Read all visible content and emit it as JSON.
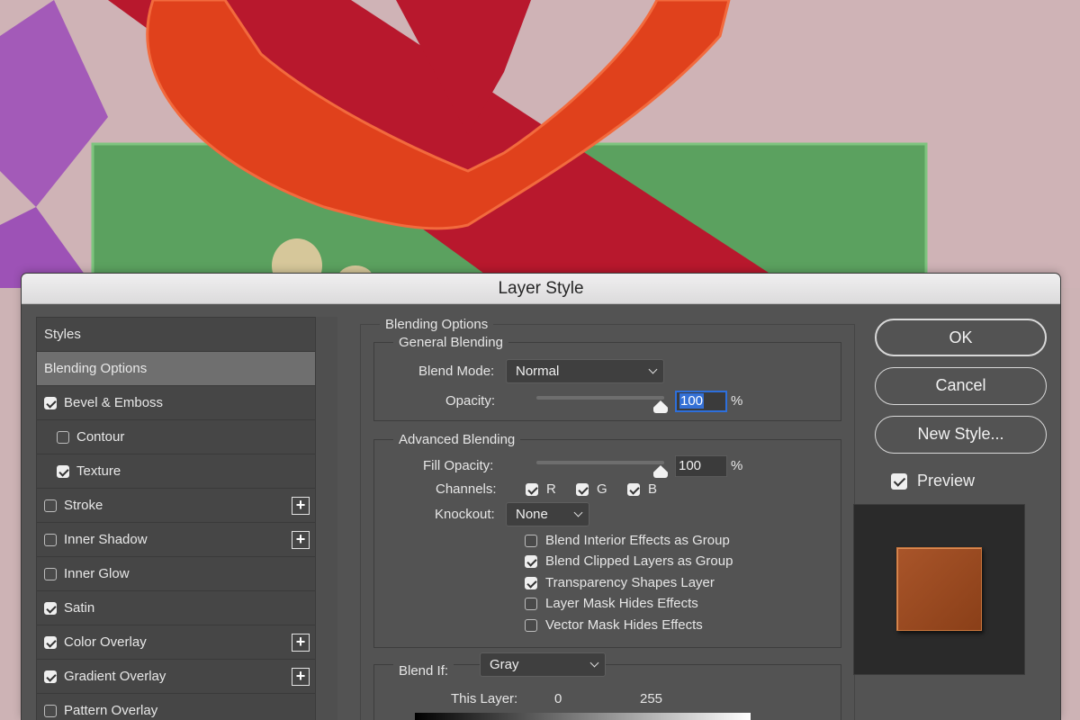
{
  "dialog": {
    "title": "Layer Style"
  },
  "styles_list": {
    "items": [
      {
        "label": "Styles",
        "kind": "header"
      },
      {
        "label": "Blending Options",
        "kind": "selected"
      },
      {
        "label": "Bevel & Emboss",
        "checked": true,
        "plus": false
      },
      {
        "label": "Contour",
        "checked": false,
        "indent": true
      },
      {
        "label": "Texture",
        "checked": true,
        "indent": true
      },
      {
        "label": "Stroke",
        "checked": false,
        "plus": true
      },
      {
        "label": "Inner Shadow",
        "checked": false,
        "plus": true
      },
      {
        "label": "Inner Glow",
        "checked": false,
        "plus": false
      },
      {
        "label": "Satin",
        "checked": true,
        "plus": false
      },
      {
        "label": "Color Overlay",
        "checked": true,
        "plus": true
      },
      {
        "label": "Gradient Overlay",
        "checked": true,
        "plus": true
      },
      {
        "label": "Pattern Overlay",
        "checked": false,
        "plus": false
      }
    ]
  },
  "blending": {
    "section_title": "Blending Options",
    "general": {
      "title": "General Blending",
      "blend_mode_label": "Blend Mode:",
      "blend_mode_value": "Normal",
      "opacity_label": "Opacity:",
      "opacity_value": "100",
      "opacity_unit": "%",
      "opacity_level": 1.0
    },
    "advanced": {
      "title": "Advanced Blending",
      "fill_opacity_label": "Fill Opacity:",
      "fill_opacity_value": "100",
      "fill_opacity_unit": "%",
      "fill_opacity_level": 1.0,
      "channels_label": "Channels:",
      "channel_r": "R",
      "channel_g": "G",
      "channel_b": "B",
      "knockout_label": "Knockout:",
      "knockout_value": "None",
      "options": [
        {
          "label": "Blend Interior Effects as Group",
          "checked": false
        },
        {
          "label": "Blend Clipped Layers as Group",
          "checked": true
        },
        {
          "label": "Transparency Shapes Layer",
          "checked": true
        },
        {
          "label": "Layer Mask Hides Effects",
          "checked": false
        },
        {
          "label": "Vector Mask Hides Effects",
          "checked": false
        }
      ]
    },
    "blend_if": {
      "label": "Blend If:",
      "value": "Gray",
      "this_layer_label": "This Layer:",
      "this_layer_low": "0",
      "this_layer_high": "255"
    }
  },
  "buttons": {
    "ok": "OK",
    "cancel": "Cancel",
    "new_style": "New Style..."
  },
  "preview": {
    "label": "Preview",
    "checked": true,
    "swatch_color": "#9a4a22"
  },
  "colors": {
    "dialog_bg": "#535353",
    "selected_row": "#6f6f6f",
    "focus_blue": "#2d6fdc"
  }
}
